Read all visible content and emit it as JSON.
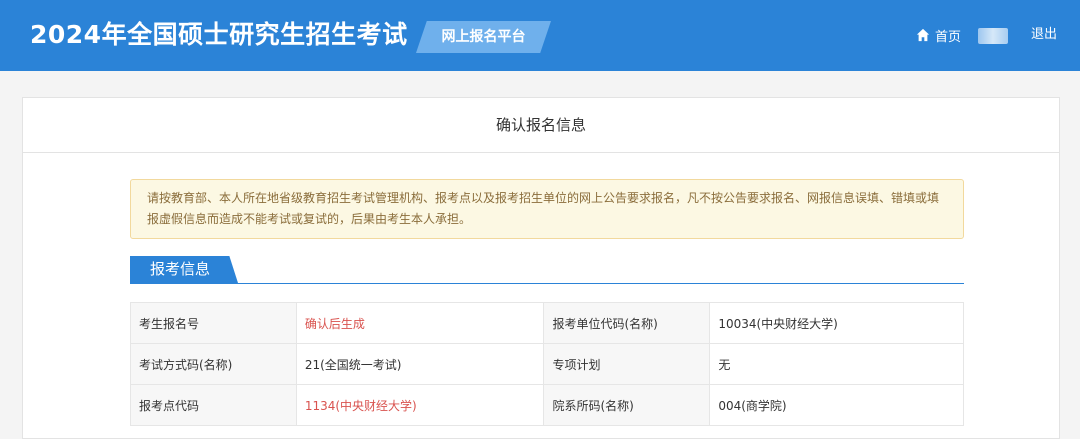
{
  "header": {
    "title": "2024年全国硕士研究生招生考试",
    "platform_tag": "网上报名平台",
    "home_label": "首页",
    "logout_label": "退出"
  },
  "panel": {
    "title": "确认报名信息",
    "notice": "请按教育部、本人所在地省级教育招生考试管理机构、报考点以及报考招生单位的网上公告要求报名，凡不按公告要求报名、网报信息误填、错填或填报虚假信息而造成不能考试或复试的，后果由考生本人承担。",
    "section_title": "报考信息"
  },
  "table": {
    "rows": [
      [
        {
          "label": "考生报名号",
          "value": "确认后生成",
          "highlight": true
        },
        {
          "label": "报考单位代码(名称)",
          "value": "10034(中央财经大学)",
          "highlight": false
        }
      ],
      [
        {
          "label": "考试方式码(名称)",
          "value": "21(全国统一考试)",
          "highlight": false
        },
        {
          "label": "专项计划",
          "value": "无",
          "highlight": false
        }
      ],
      [
        {
          "label": "报考点代码",
          "value": "1134(中央财经大学)",
          "highlight": true
        },
        {
          "label": "院系所码(名称)",
          "value": "004(商学院)",
          "highlight": false
        }
      ]
    ]
  },
  "colors": {
    "header_bg": "#2b83d7",
    "highlight_text": "#d9534f",
    "notice_bg": "#fcf8e3"
  },
  "icons": {
    "home": "home-icon"
  }
}
